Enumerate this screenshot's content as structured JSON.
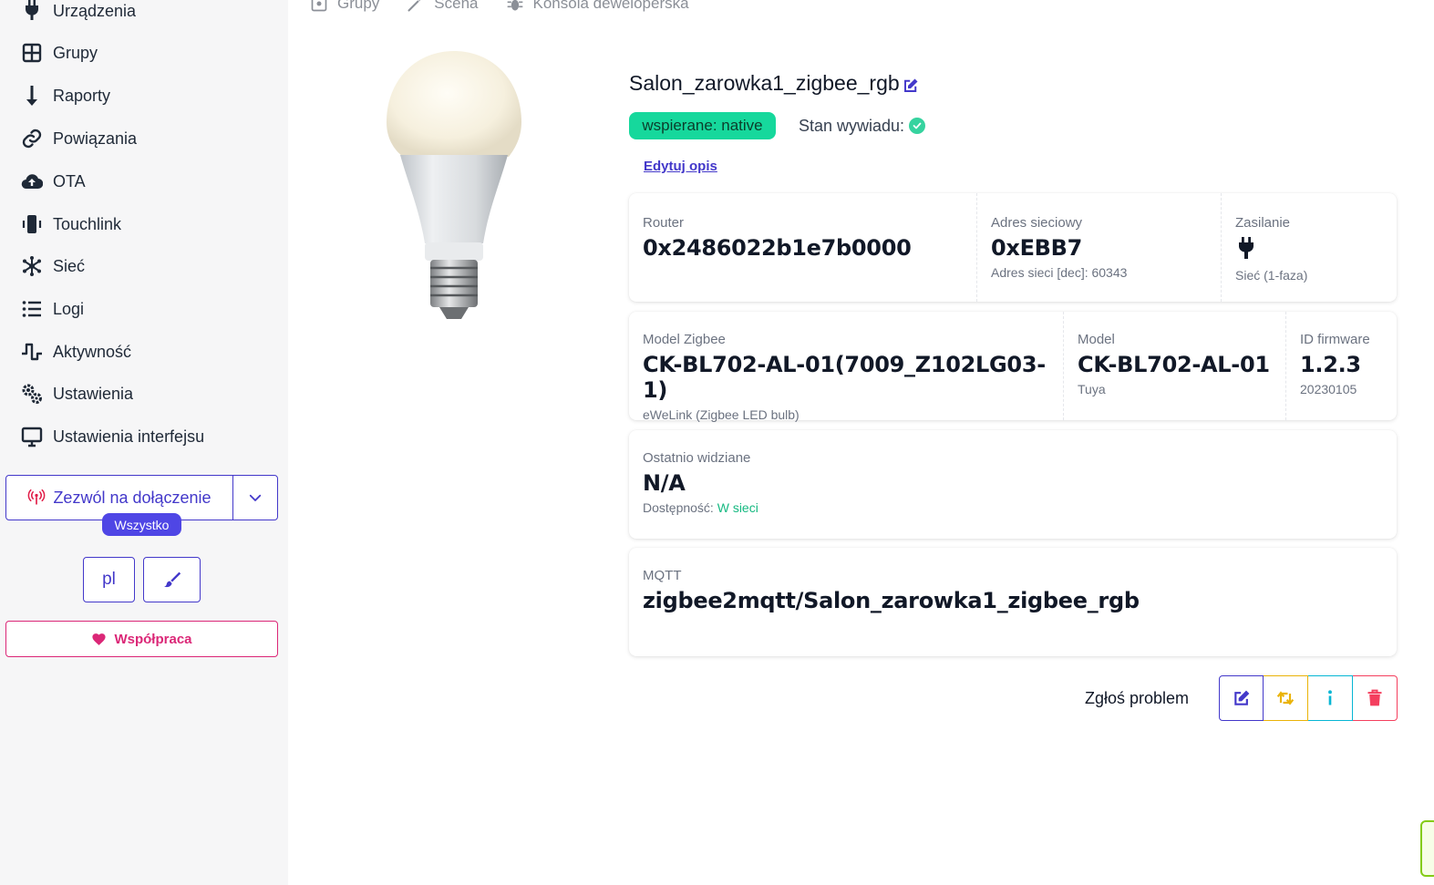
{
  "sidebar": {
    "items": [
      {
        "label": "Urządzenia",
        "icon": "plug-icon"
      },
      {
        "label": "Grupy",
        "icon": "grid-icon"
      },
      {
        "label": "Raporty",
        "icon": "arrow-down-icon"
      },
      {
        "label": "Powiązania",
        "icon": "link-icon"
      },
      {
        "label": "OTA",
        "icon": "cloud-upload-icon"
      },
      {
        "label": "Touchlink",
        "icon": "mobile-vibrate-icon"
      },
      {
        "label": "Sieć",
        "icon": "network-icon"
      },
      {
        "label": "Logi",
        "icon": "list-icon"
      },
      {
        "label": "Aktywność",
        "icon": "wave-square-icon"
      },
      {
        "label": "Ustawienia",
        "icon": "gears-icon"
      },
      {
        "label": "Ustawienia interfejsu",
        "icon": "desktop-icon"
      }
    ],
    "permit_join_label": "Zezwól na dołączenie",
    "permit_join_badge": "Wszystko",
    "language_label": "pl",
    "cooperation_label": "Współpraca"
  },
  "top_tabs": [
    {
      "label": "Grupy",
      "icon": "groups-icon"
    },
    {
      "label": "Scena",
      "icon": "magic-wand-icon"
    },
    {
      "label": "Konsola deweloperska",
      "icon": "bug-icon"
    }
  ],
  "device": {
    "title": "Salon_zarowka1_zigbee_rgb",
    "support_badge": "wspierane: native",
    "interview_label": "Stan wywiadu:",
    "edit_description": "Edytuj opis",
    "router_label": "Router",
    "router_value": "0x2486022b1e7b0000",
    "network_address_label": "Adres sieciowy",
    "network_address_value": "0xEBB7",
    "network_address_dec": "Adres sieci [dec]: 60343",
    "power_label": "Zasilanie",
    "power_source": "Sieć (1-faza)",
    "zigbee_model_label": "Model Zigbee",
    "zigbee_model_value": "CK-BL702-AL-01(7009_Z102LG03-1)",
    "zigbee_model_desc": "eWeLink (Zigbee LED bulb)",
    "model_label": "Model",
    "model_value": "CK-BL702-AL-01",
    "model_vendor": "Tuya",
    "firmware_label": "ID firmware",
    "firmware_value": "1.2.3",
    "firmware_date": "20230105",
    "last_seen_label": "Ostatnio widziane",
    "last_seen_value": "N/A",
    "availability_label": "Dostępność:",
    "availability_value": "W sieci",
    "mqtt_label": "MQTT",
    "mqtt_value": "zigbee2mqtt/Salon_zarowka1_zigbee_rgb"
  },
  "actions": {
    "report_problem": "Zgłoś problem"
  },
  "colors": {
    "accent": "#4338ca",
    "support_badge": "#16d89c",
    "online": "#16b981",
    "cooperation": "#db2777",
    "refresh": "#eab308",
    "info": "#06b6d4",
    "delete": "#f43f5e"
  }
}
